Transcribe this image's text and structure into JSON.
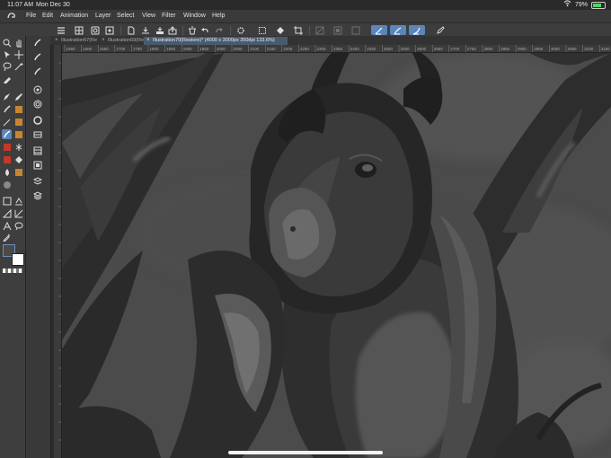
{
  "status_bar": {
    "time": "11:07 AM",
    "date": "Mon Dec 30",
    "battery": "79%"
  },
  "menu": [
    "File",
    "Edit",
    "Animation",
    "Layer",
    "Select",
    "View",
    "Filter",
    "Window",
    "Help"
  ],
  "tabs": [
    {
      "label": "Illustration67(Re"
    },
    {
      "label": "Illustration69(Re"
    },
    {
      "label": "Illustration70(Restore)* (4000 x 3000px 350dpi 133.6%)"
    }
  ],
  "ruler_ticks": [
    "1550",
    "1600",
    "1650",
    "1700",
    "1750",
    "1800",
    "1850",
    "1900",
    "1950",
    "2000",
    "2050",
    "2100",
    "2150",
    "2200",
    "2250",
    "2300",
    "2350",
    "2400",
    "2450",
    "2500",
    "2550",
    "2600",
    "2650",
    "2700",
    "2750",
    "2800",
    "2850",
    "2900",
    "2950",
    "3000",
    "3050",
    "3100",
    "3150"
  ],
  "colors": {
    "main": "#4a4a4a",
    "sub": "#ffffff",
    "accent": "#5b86b8"
  }
}
